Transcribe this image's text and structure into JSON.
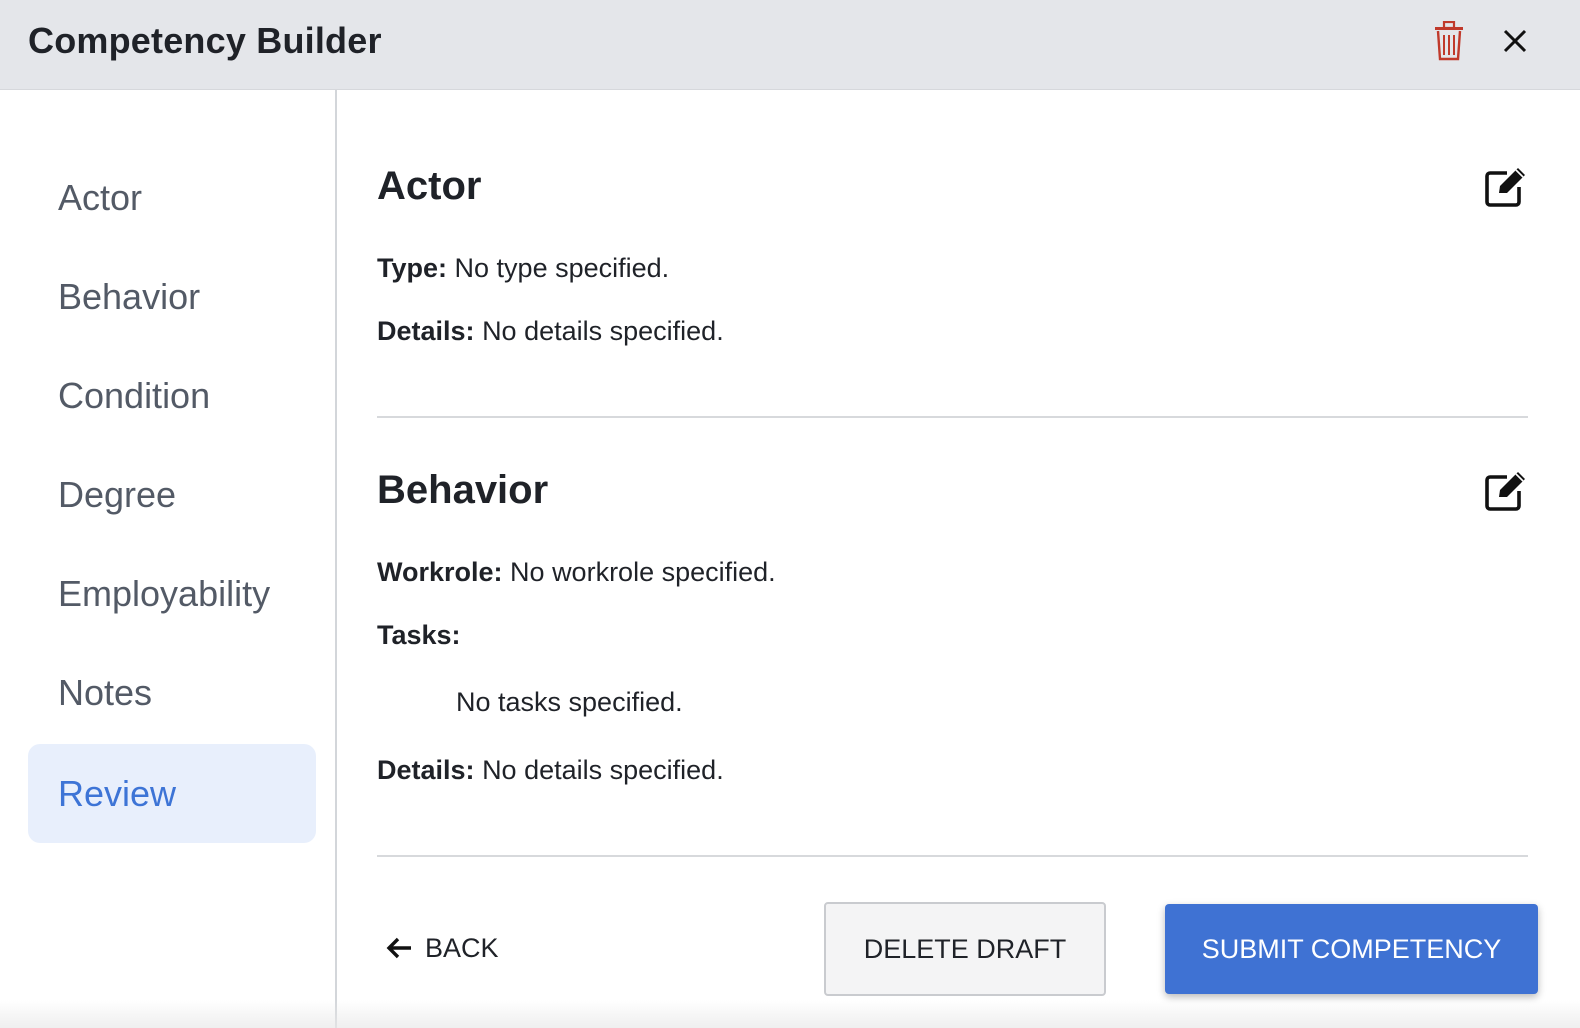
{
  "header": {
    "title": "Competency Builder",
    "trash_icon": "trash-icon",
    "close_icon": "close-icon",
    "trash_color": "#c0392b"
  },
  "sidebar": {
    "items": [
      {
        "label": "Actor",
        "active": false
      },
      {
        "label": "Behavior",
        "active": false
      },
      {
        "label": "Condition",
        "active": false
      },
      {
        "label": "Degree",
        "active": false
      },
      {
        "label": "Employability",
        "active": false
      },
      {
        "label": "Notes",
        "active": false
      },
      {
        "label": "Review",
        "active": true
      }
    ],
    "active_color": "#3d74d6"
  },
  "sections": {
    "actor": {
      "title": "Actor",
      "edit_icon": "edit-icon",
      "type_label": "Type:",
      "type_value": "No type specified.",
      "details_label": "Details:",
      "details_value": "No details specified."
    },
    "behavior": {
      "title": "Behavior",
      "edit_icon": "edit-icon",
      "workrole_label": "Workrole:",
      "workrole_value": "No workrole specified.",
      "tasks_label": "Tasks:",
      "tasks_value": "No tasks specified.",
      "details_label": "Details:",
      "details_value": "No details specified."
    }
  },
  "footer": {
    "back_label": "BACK",
    "back_icon": "arrow-left-icon",
    "delete_label": "DELETE DRAFT",
    "submit_label": "SUBMIT COMPETENCY",
    "submit_color": "#3f72d3"
  }
}
